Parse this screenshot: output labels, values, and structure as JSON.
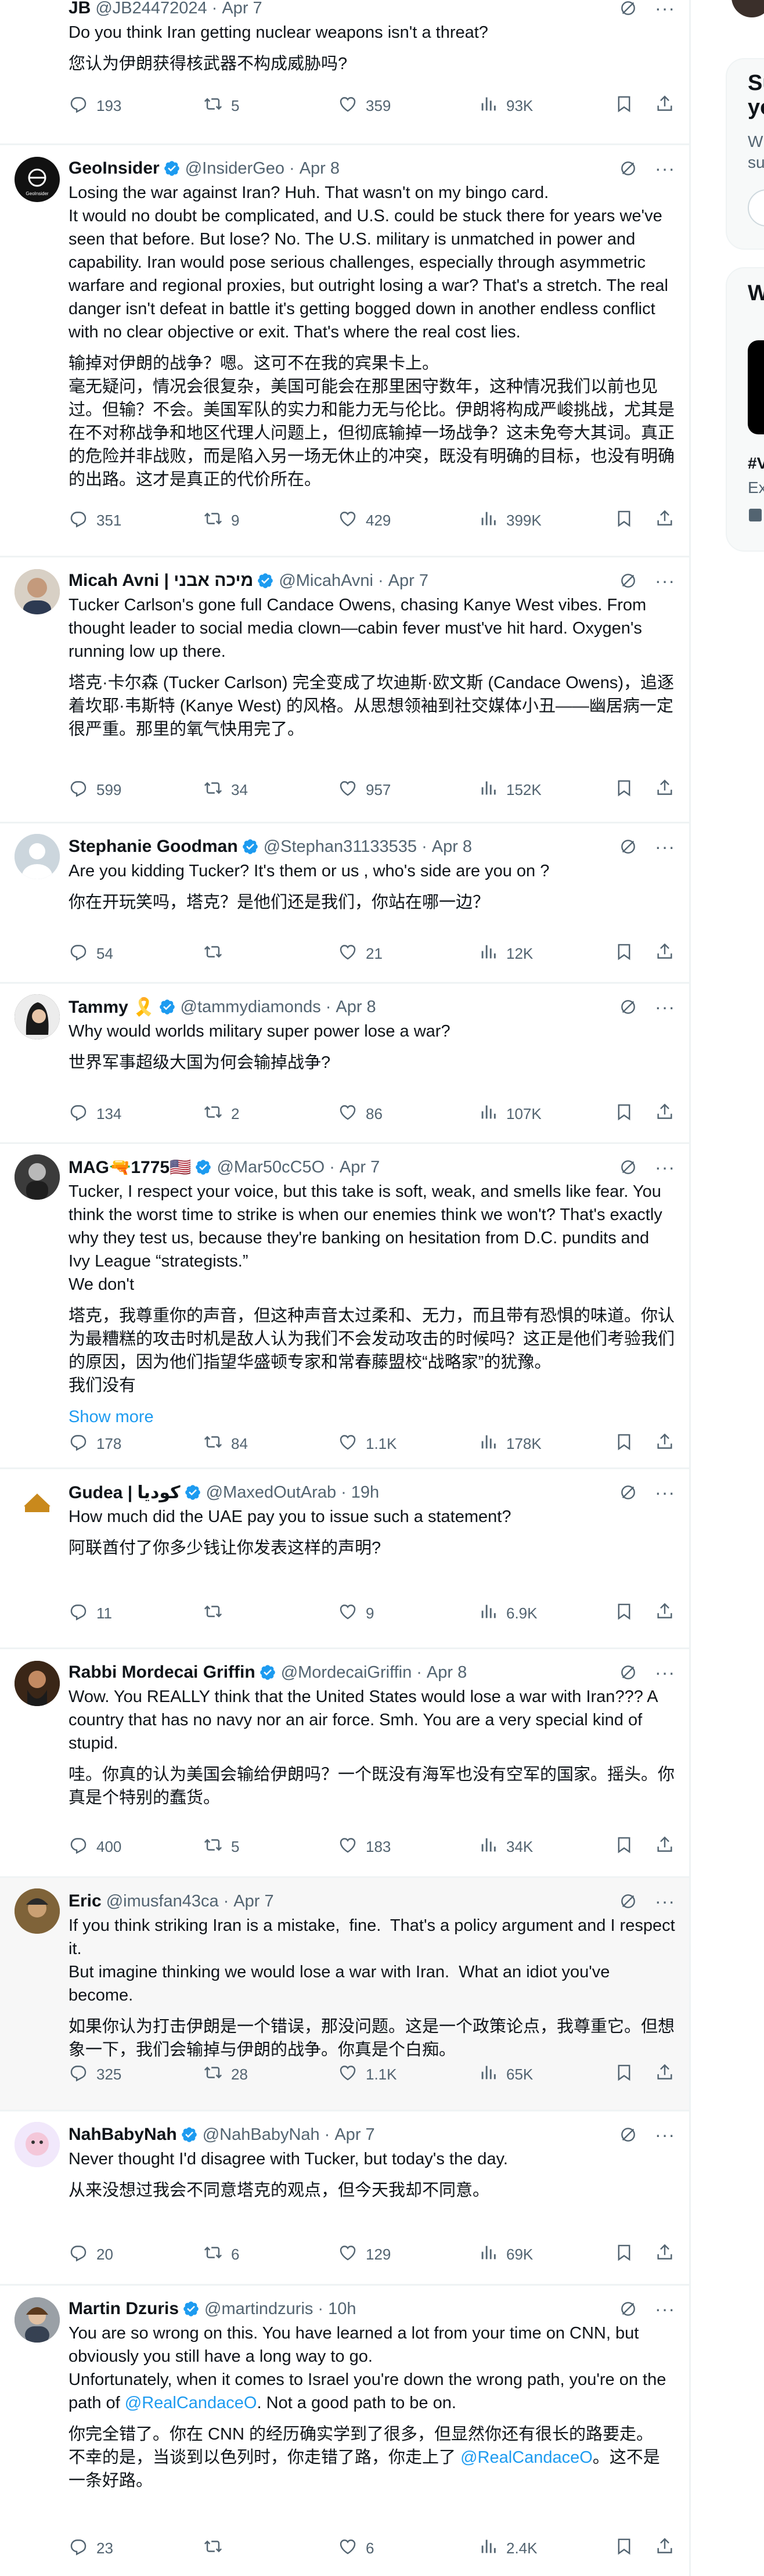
{
  "actions_icons": [
    "reply-icon",
    "repost-icon",
    "like-icon",
    "views-icon",
    "bookmark-icon",
    "share-icon"
  ],
  "colors": {
    "accent": "#1d9bf0",
    "text": "#0f1419",
    "muted": "#536471",
    "border": "#eff3f4"
  },
  "tweets": [
    {
      "name": "JB",
      "handle": "@JB24472024",
      "date": "Apr 7",
      "verified": false,
      "text": "Do you think Iran getting nuclear weapons isn't a threat?",
      "translation": "您认为伊朗获得核武器不构成威胁吗?",
      "replies": "193",
      "reposts": "5",
      "likes": "359",
      "views": "93K"
    },
    {
      "name": "GeoInsider",
      "handle": "@InsiderGeo",
      "date": "Apr 8",
      "verified": true,
      "text": "Losing the war against Iran? Huh. That wasn't on my bingo card.\nIt would no doubt be complicated, and U.S. could be stuck there for years we've seen that before. But lose? No. The U.S. military is unmatched in power and capability. Iran would pose serious challenges, especially through asymmetric warfare and regional proxies, but outright losing a war? That's a stretch. The real danger isn't defeat in battle it's getting bogged down in another endless conflict with no clear objective or exit. That's where the real cost lies.",
      "translation": "输掉对伊朗的战争？嗯。这可不在我的宾果卡上。\n毫无疑问，情况会很复杂，美国可能会在那里困守数年，这种情况我们以前也见过。但输？不会。美国军队的实力和能力无与伦比。伊朗将构成严峻挑战，尤其是在不对称战争和地区代理人问题上，但彻底输掉一场战争？这未免夸大其词。真正的危险并非战败，而是陷入另一场无休止的冲突，既没有明确的目标，也没有明确的出路。这才是真正的代价所在。",
      "replies": "351",
      "reposts": "9",
      "likes": "429",
      "views": "399K"
    },
    {
      "name": "Micah Avni | מיכה אבני",
      "handle": "@MicahAvni",
      "date": "Apr 7",
      "verified": true,
      "text": "Tucker Carlson's gone full Candace Owens, chasing Kanye West vibes. From thought leader to social media clown—cabin fever must've hit hard. Oxygen's running low up there.",
      "translation": "塔克·卡尔森 (Tucker Carlson) 完全变成了坎迪斯·欧文斯 (Candace Owens)，追逐着坎耶·韦斯特 (Kanye West) 的风格。从思想领袖到社交媒体小丑——幽居病一定很严重。那里的氧气快用完了。",
      "replies": "599",
      "reposts": "34",
      "likes": "957",
      "views": "152K"
    },
    {
      "name": "Stephanie Goodman",
      "handle": "@Stephan31133535",
      "date": "Apr 8",
      "verified": true,
      "text": "Are you kidding Tucker? It's them or us , who's side are you on ?",
      "translation": "你在开玩笑吗，塔克？是他们还是我们，你站在哪一边？",
      "replies": "54",
      "reposts": "",
      "likes": "21",
      "views": "12K"
    },
    {
      "name": "Tammy 🎗️",
      "handle": "@tammydiamonds",
      "date": "Apr 8",
      "verified": true,
      "text": "Why would worlds military super power lose a war?",
      "translation": "世界军事超级大国为何会输掉战争?",
      "replies": "134",
      "reposts": "2",
      "likes": "86",
      "views": "107K"
    },
    {
      "name": "MAG🔫1775🇺🇸",
      "handle": "@Mar50cC5O",
      "date": "Apr 7",
      "verified": true,
      "text": "Tucker, I respect your voice, but this take is soft, weak, and smells like fear. You think the worst time to strike is when our enemies think we won't? That's exactly why they test us, because they're banking on hesitation from D.C. pundits and Ivy League “strategists.”\nWe don't",
      "translation": "塔克，我尊重你的声音，但这种声音太过柔和、无力，而且带有恐惧的味道。你认为最糟糕的攻击时机是敌人认为我们不会发动攻击的时候吗？这正是他们考验我们的原因，因为他们指望华盛顿专家和常春藤盟校“战略家”的犹豫。\n我们没有",
      "show_more": "Show more",
      "replies": "178",
      "reposts": "84",
      "likes": "1.1K",
      "views": "178K"
    },
    {
      "name": "Gudea | كوديا",
      "handle": "@MaxedOutArab",
      "date": "19h",
      "verified": true,
      "text": "How much did the UAE pay you to issue such a statement?",
      "translation": "阿联酋付了你多少钱让你发表这样的声明?",
      "replies": "11",
      "reposts": "",
      "likes": "9",
      "views": "6.9K"
    },
    {
      "name": "Rabbi Mordecai Griffin",
      "handle": "@MordecaiGriffin",
      "date": "Apr 8",
      "verified": true,
      "text": "Wow. You REALLY think that the United States would lose a war with Iran??? A country that has no navy nor an air force. Smh. You are a very special kind of stupid.",
      "translation": "哇。你真的认为美国会输给伊朗吗？一个既没有海军也没有空军的国家。摇头。你真是个特别的蠢货。",
      "replies": "400",
      "reposts": "5",
      "likes": "183",
      "views": "34K"
    },
    {
      "name": "Eric",
      "handle": "@imusfan43ca",
      "date": "Apr 7",
      "verified": false,
      "text": "If you think striking Iran is a mistake,  fine.  That's a policy argument and I respect it.\nBut imagine thinking we would lose a war with Iran.  What an idiot you've become.",
      "translation": "如果你认为打击伊朗是一个错误，那没问题。这是一个政策论点，我尊重它。但想象一下，我们会输掉与伊朗的战争。你真是个白痴。",
      "replies": "325",
      "reposts": "28",
      "likes": "1.1K",
      "views": "65K"
    },
    {
      "name": "NahBabyNah",
      "handle": "@NahBabyNah",
      "date": "Apr 7",
      "verified": true,
      "text": "Never thought I'd disagree with Tucker, but today's the day.",
      "translation": "从来没想过我会不同意塔克的观点，但今天我却不同意。",
      "replies": "20",
      "reposts": "6",
      "likes": "129",
      "views": "69K"
    },
    {
      "name": "Martin Dzuris",
      "handle": "@martindzuris",
      "date": "10h",
      "verified": true,
      "text_a": "You are so wrong on this. You have learned a lot from your time on CNN, but obviously you still have a long way to go.\nUnfortunately, when it comes to Israel you're down the wrong path, you're on the path of ",
      "mention": "@RealCandaceO",
      "text_b": ". Not a good path to be on.",
      "translation_a": "你完全错了。你在 CNN 的经历确实学到了很多，但显然你还有很长的路要走。\n不幸的是，当谈到以色列时，你走错了路，你走上了 ",
      "translation_b": "。这不是一条好路。",
      "replies": "23",
      "reposts": "",
      "likes": "6",
      "views": "2.4K"
    }
  ],
  "sidebar": {
    "title_1": "Su",
    "title_1b": "yo",
    "sub_1": "W",
    "sub_1b": "su",
    "title_2": "W",
    "trend": "#V",
    "trend_sub": "Ex"
  }
}
